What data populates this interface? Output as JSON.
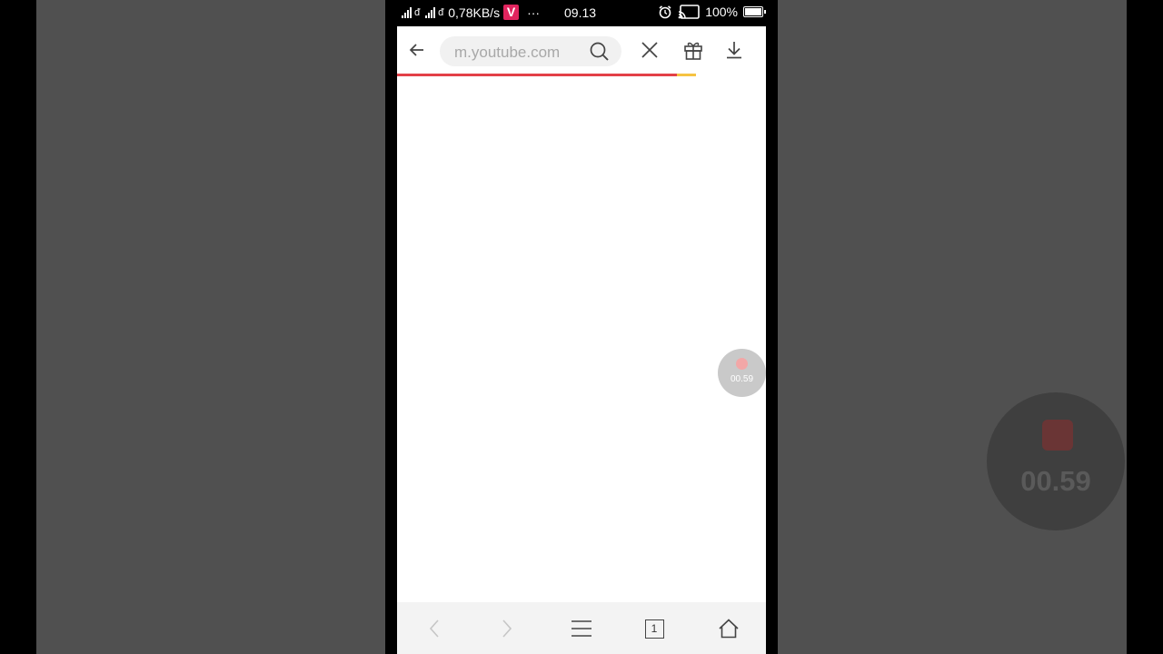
{
  "status_bar": {
    "network_speed": "0,78KB/s",
    "app_badge": "V",
    "more_dots": "···",
    "time": "09.13",
    "battery_percent": "100%"
  },
  "browser": {
    "url": "m.youtube.com",
    "progress_percent": 81,
    "open_tab_count": "1"
  },
  "recorder": {
    "elapsed": "00.59"
  },
  "colors": {
    "progress_red": "#e34047",
    "progress_yellow": "#f6c342",
    "side_background": "#505050"
  }
}
